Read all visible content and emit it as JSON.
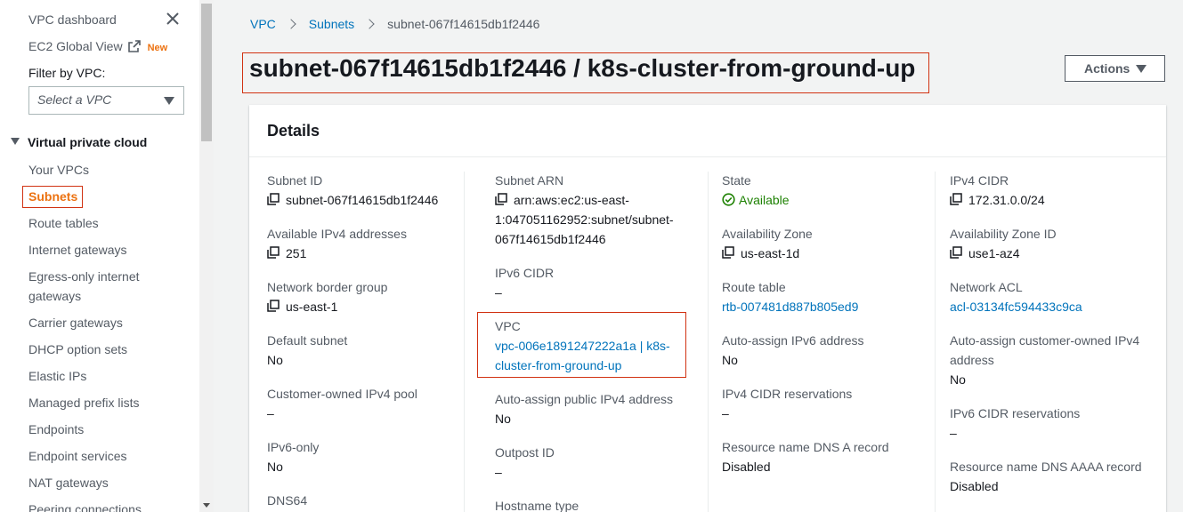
{
  "sidebar": {
    "dashboard": "VPC dashboard",
    "ec2_global_view": "EC2 Global View",
    "new_badge": "New",
    "filter_label": "Filter by VPC:",
    "filter_placeholder": "Select a VPC",
    "section": "Virtual private cloud",
    "items": [
      {
        "label": "Your VPCs"
      },
      {
        "label": "Subnets"
      },
      {
        "label": "Route tables"
      },
      {
        "label": "Internet gateways"
      },
      {
        "label": "Egress-only internet"
      },
      {
        "label": "gateways"
      },
      {
        "label": "Carrier gateways"
      },
      {
        "label": "DHCP option sets"
      },
      {
        "label": "Elastic IPs"
      },
      {
        "label": "Managed prefix lists"
      },
      {
        "label": "Endpoints"
      },
      {
        "label": "Endpoint services"
      },
      {
        "label": "NAT gateways"
      },
      {
        "label": "Peering connections"
      }
    ]
  },
  "breadcrumb": {
    "vpc": "VPC",
    "subnets": "Subnets",
    "current": "subnet-067f14615db1f2446"
  },
  "page_title": "subnet-067f14615db1f2446 / k8s-cluster-from-ground-up",
  "actions_label": "Actions",
  "details": {
    "title": "Details",
    "subnet_id": {
      "label": "Subnet ID",
      "value": "subnet-067f14615db1f2446"
    },
    "available_ipv4": {
      "label": "Available IPv4 addresses",
      "value": "251"
    },
    "network_border_group": {
      "label": "Network border group",
      "value": "us-east-1"
    },
    "default_subnet": {
      "label": "Default subnet",
      "value": "No"
    },
    "customer_owned_pool": {
      "label": "Customer-owned IPv4 pool",
      "value": "–"
    },
    "ipv6_only": {
      "label": "IPv6-only",
      "value": "No"
    },
    "dns64": {
      "label": "DNS64"
    },
    "subnet_arn": {
      "label": "Subnet ARN",
      "line1": "arn:aws:ec2:us-east-",
      "line2": "1:047051162952:subnet/subnet-",
      "line3": "067f14615db1f2446"
    },
    "ipv6_cidr": {
      "label": "IPv6 CIDR",
      "value": "–"
    },
    "vpc": {
      "label": "VPC",
      "line1": "vpc-006e1891247222a1a | k8s-",
      "line2": "cluster-from-ground-up"
    },
    "auto_assign_public_ipv4": {
      "label": "Auto-assign public IPv4 address",
      "value": "No"
    },
    "outpost_id": {
      "label": "Outpost ID",
      "value": "–"
    },
    "hostname_type": {
      "label": "Hostname type"
    },
    "state": {
      "label": "State",
      "value": "Available"
    },
    "availability_zone": {
      "label": "Availability Zone",
      "value": "us-east-1d"
    },
    "route_table": {
      "label": "Route table",
      "value": "rtb-007481d887b805ed9"
    },
    "auto_assign_ipv6": {
      "label": "Auto-assign IPv6 address",
      "value": "No"
    },
    "ipv4_cidr_reservations": {
      "label": "IPv4 CIDR reservations",
      "value": "–"
    },
    "dns_a_record": {
      "label": "Resource name DNS A record",
      "value": "Disabled"
    },
    "ipv4_cidr": {
      "label": "IPv4 CIDR",
      "value": "172.31.0.0/24"
    },
    "az_id": {
      "label": "Availability Zone ID",
      "value": "use1-az4"
    },
    "network_acl": {
      "label": "Network ACL",
      "value": "acl-03134fc594433c9ca"
    },
    "auto_assign_customer_owned": {
      "label_line1": "Auto-assign customer-owned IPv4",
      "label_line2": "address",
      "value": "No"
    },
    "ipv6_cidr_reservations": {
      "label": "IPv6 CIDR reservations",
      "value": "–"
    },
    "dns_aaaa_record": {
      "label": "Resource name DNS AAAA record",
      "value": "Disabled"
    }
  },
  "colors": {
    "link": "#0073bb",
    "active": "#ec7211",
    "highlight_border": "#d13212",
    "success": "#1d8102"
  }
}
